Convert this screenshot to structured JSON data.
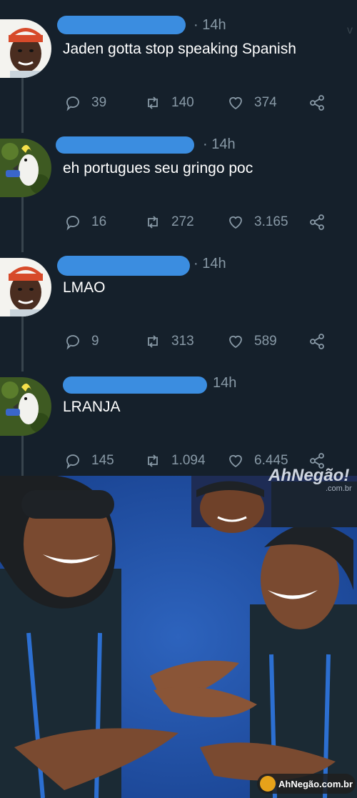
{
  "tweets": [
    {
      "time": "· 14h",
      "text": "Jaden gotta stop speaking Spanish",
      "replies": "39",
      "retweets": "140",
      "likes": "374",
      "avatar": "person-avatar"
    },
    {
      "time": "· 14h",
      "text": "eh portugues seu gringo poc",
      "replies": "16",
      "retweets": "272",
      "likes": "3.165",
      "avatar": "cockatoo-avatar"
    },
    {
      "time": "· 14h",
      "text": "LMAO",
      "replies": "9",
      "retweets": "313",
      "likes": "589",
      "avatar": "person-avatar"
    },
    {
      "time": "14h",
      "text": "LRANJA",
      "replies": "145",
      "retweets": "1.094",
      "likes": "6.445",
      "avatar": "cockatoo-avatar"
    }
  ],
  "top_right_mark": "v",
  "watermark": {
    "top": "AhNegão!",
    "top_sub": ".com.br",
    "bottom": "AhNegão.com.br"
  },
  "colors": {
    "background": "#15202b",
    "muted_text": "#8899a6",
    "redaction": "#3b8de0",
    "meme_background": "#1f4fa5"
  },
  "icons": [
    "reply-icon",
    "retweet-icon",
    "like-icon",
    "share-icon"
  ]
}
